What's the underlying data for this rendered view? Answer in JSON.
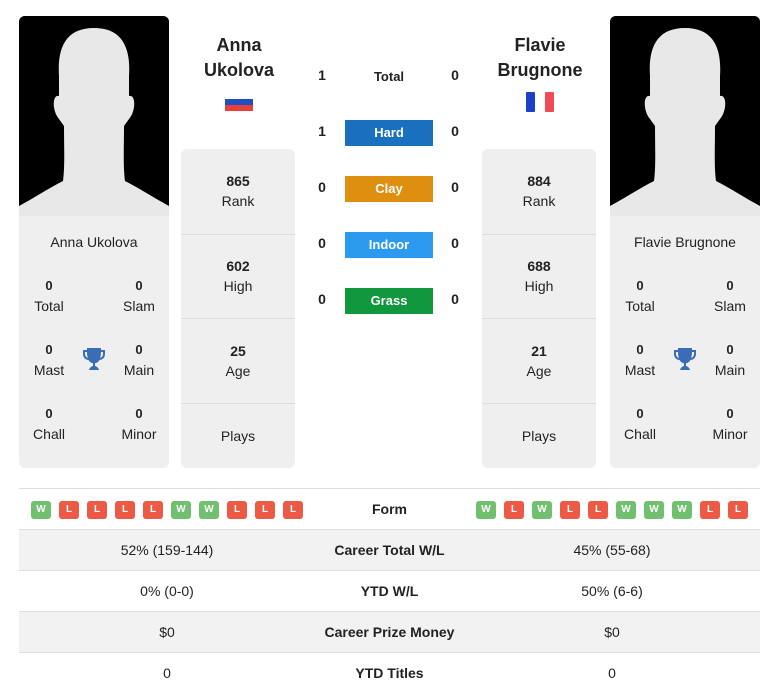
{
  "colors": {
    "hard": "#1a6fbf",
    "clay": "#df8f10",
    "indoor": "#2c9bef",
    "grass": "#11973d",
    "win": "#70c070",
    "loss": "#ec5a45",
    "trophy": "#3a6db5"
  },
  "player1": {
    "name": "Anna Ukolova",
    "name_line1": "Anna",
    "name_line2": "Ukolova",
    "flag": "russia-flag",
    "titles": {
      "total": "0",
      "total_label": "Total",
      "slam": "0",
      "slam_label": "Slam",
      "mast": "0",
      "mast_label": "Mast",
      "main": "0",
      "main_label": "Main",
      "chall": "0",
      "chall_label": "Chall",
      "minor": "0",
      "minor_label": "Minor"
    },
    "rank": "865",
    "rank_label": "Rank",
    "high": "602",
    "high_label": "High",
    "age": "25",
    "age_label": "Age",
    "plays_label": "Plays",
    "form": [
      "W",
      "L",
      "L",
      "L",
      "L",
      "W",
      "W",
      "L",
      "L",
      "L"
    ],
    "career_wl": "52% (159-144)",
    "ytd_wl": "0% (0-0)",
    "prize": "$0",
    "ytd_titles": "0"
  },
  "player2": {
    "name": "Flavie Brugnone",
    "name_line1": "Flavie",
    "name_line2": "Brugnone",
    "flag": "france-flag",
    "titles": {
      "total": "0",
      "total_label": "Total",
      "slam": "0",
      "slam_label": "Slam",
      "mast": "0",
      "mast_label": "Mast",
      "main": "0",
      "main_label": "Main",
      "chall": "0",
      "chall_label": "Chall",
      "minor": "0",
      "minor_label": "Minor"
    },
    "rank": "884",
    "rank_label": "Rank",
    "high": "688",
    "high_label": "High",
    "age": "21",
    "age_label": "Age",
    "plays_label": "Plays",
    "form": [
      "W",
      "L",
      "W",
      "L",
      "L",
      "W",
      "W",
      "W",
      "L",
      "L"
    ],
    "career_wl": "45% (55-68)",
    "ytd_wl": "50% (6-6)",
    "prize": "$0",
    "ytd_titles": "0"
  },
  "h2h": [
    {
      "label": "Total",
      "p1": "1",
      "p2": "0"
    },
    {
      "label": "Hard",
      "p1": "1",
      "p2": "0"
    },
    {
      "label": "Clay",
      "p1": "0",
      "p2": "0"
    },
    {
      "label": "Indoor",
      "p1": "0",
      "p2": "0"
    },
    {
      "label": "Grass",
      "p1": "0",
      "p2": "0"
    }
  ],
  "table_labels": {
    "form": "Form",
    "career_wl": "Career Total W/L",
    "ytd_wl": "YTD W/L",
    "prize": "Career Prize Money",
    "ytd_titles": "YTD Titles"
  }
}
